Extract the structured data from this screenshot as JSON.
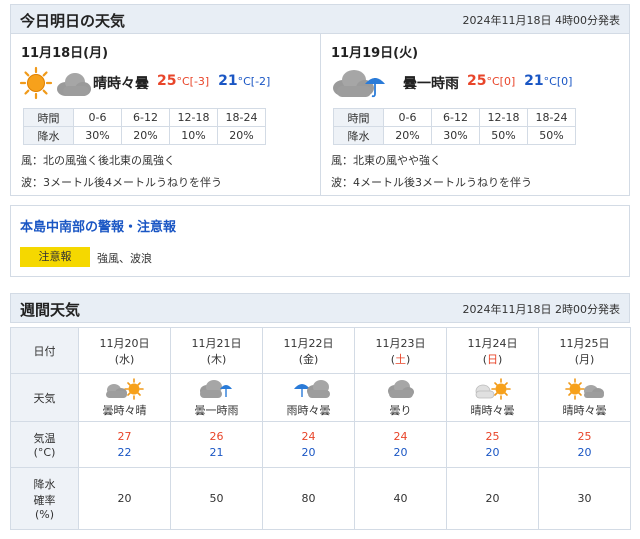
{
  "today": {
    "title": "今日明日の天気",
    "issued": "2024年11月18日 4時00分発表",
    "days": [
      {
        "date": "11月18日(月)",
        "weather": "晴時々曇",
        "icon": "sun-cloud-icon",
        "high": "25",
        "high_diff": "[-3]",
        "low": "21",
        "low_diff": "[-2]",
        "unit": "°C",
        "rain_label_time": "時間",
        "rain_label_precip": "降水",
        "periods": [
          "0-6",
          "6-12",
          "12-18",
          "18-24"
        ],
        "rain": [
          "30%",
          "20%",
          "10%",
          "20%"
        ],
        "wind": "風：北の風強く後北東の風強く",
        "wave": "波：3メートル後4メートルうねりを伴う"
      },
      {
        "date": "11月19日(火)",
        "weather": "曇一時雨",
        "icon": "cloud-umbrella-icon",
        "high": "25",
        "high_diff": "[0]",
        "low": "21",
        "low_diff": "[0]",
        "unit": "°C",
        "rain_label_time": "時間",
        "rain_label_precip": "降水",
        "periods": [
          "0-6",
          "6-12",
          "12-18",
          "18-24"
        ],
        "rain": [
          "20%",
          "30%",
          "50%",
          "50%"
        ],
        "wind": "風：北東の風やや強く",
        "wave": "波：4メートル後3メートルうねりを伴う"
      }
    ]
  },
  "warning": {
    "title": "本島中南部の警報・注意報",
    "badge": "注意報",
    "text": "強風、波浪",
    "badge_color": "#f5d800"
  },
  "weekly": {
    "title": "週間天気",
    "issued": "2024年11月18日 2時00分発表",
    "labels": {
      "date": "日付",
      "weather": "天気",
      "temp": "気温\n(°C)",
      "temp_line1": "気温",
      "temp_line2": "(°C)",
      "rain_line1": "降水",
      "rain_line2": "確率",
      "rain_line3": "(%)"
    },
    "days": [
      {
        "date": "11月20日",
        "dow": "(水)",
        "weather": "曇時々晴",
        "icon": "cloud-sun-icon",
        "high": "27",
        "low": "22",
        "rain": "20"
      },
      {
        "date": "11月21日",
        "dow": "(木)",
        "weather": "曇一時雨",
        "icon": "cloud-umbrella-icon",
        "high": "26",
        "low": "21",
        "rain": "50"
      },
      {
        "date": "11月22日",
        "dow": "(金)",
        "weather": "雨時々曇",
        "icon": "umbrella-cloud-icon",
        "high": "24",
        "low": "20",
        "rain": "80"
      },
      {
        "date": "11月23日",
        "dow_open": "(",
        "dow_char": "土",
        "dow_close": ")",
        "weather": "曇り",
        "icon": "cloud-icon",
        "high": "24",
        "low": "20",
        "rain": "40"
      },
      {
        "date": "11月24日",
        "dow_open": "(",
        "dow_char": "日",
        "dow_close": ")",
        "weather": "晴時々曇",
        "icon": "light-cloud-sun-icon",
        "high": "25",
        "low": "20",
        "rain": "20"
      },
      {
        "date": "11月25日",
        "dow": "(月)",
        "weather": "晴時々曇",
        "icon": "sun-cloud-icon",
        "high": "25",
        "low": "20",
        "rain": "30"
      }
    ]
  },
  "colors": {
    "high": "#e8452a",
    "low": "#1a56c4",
    "header_bg": "#e8eef5",
    "border": "#d3dbe5"
  }
}
